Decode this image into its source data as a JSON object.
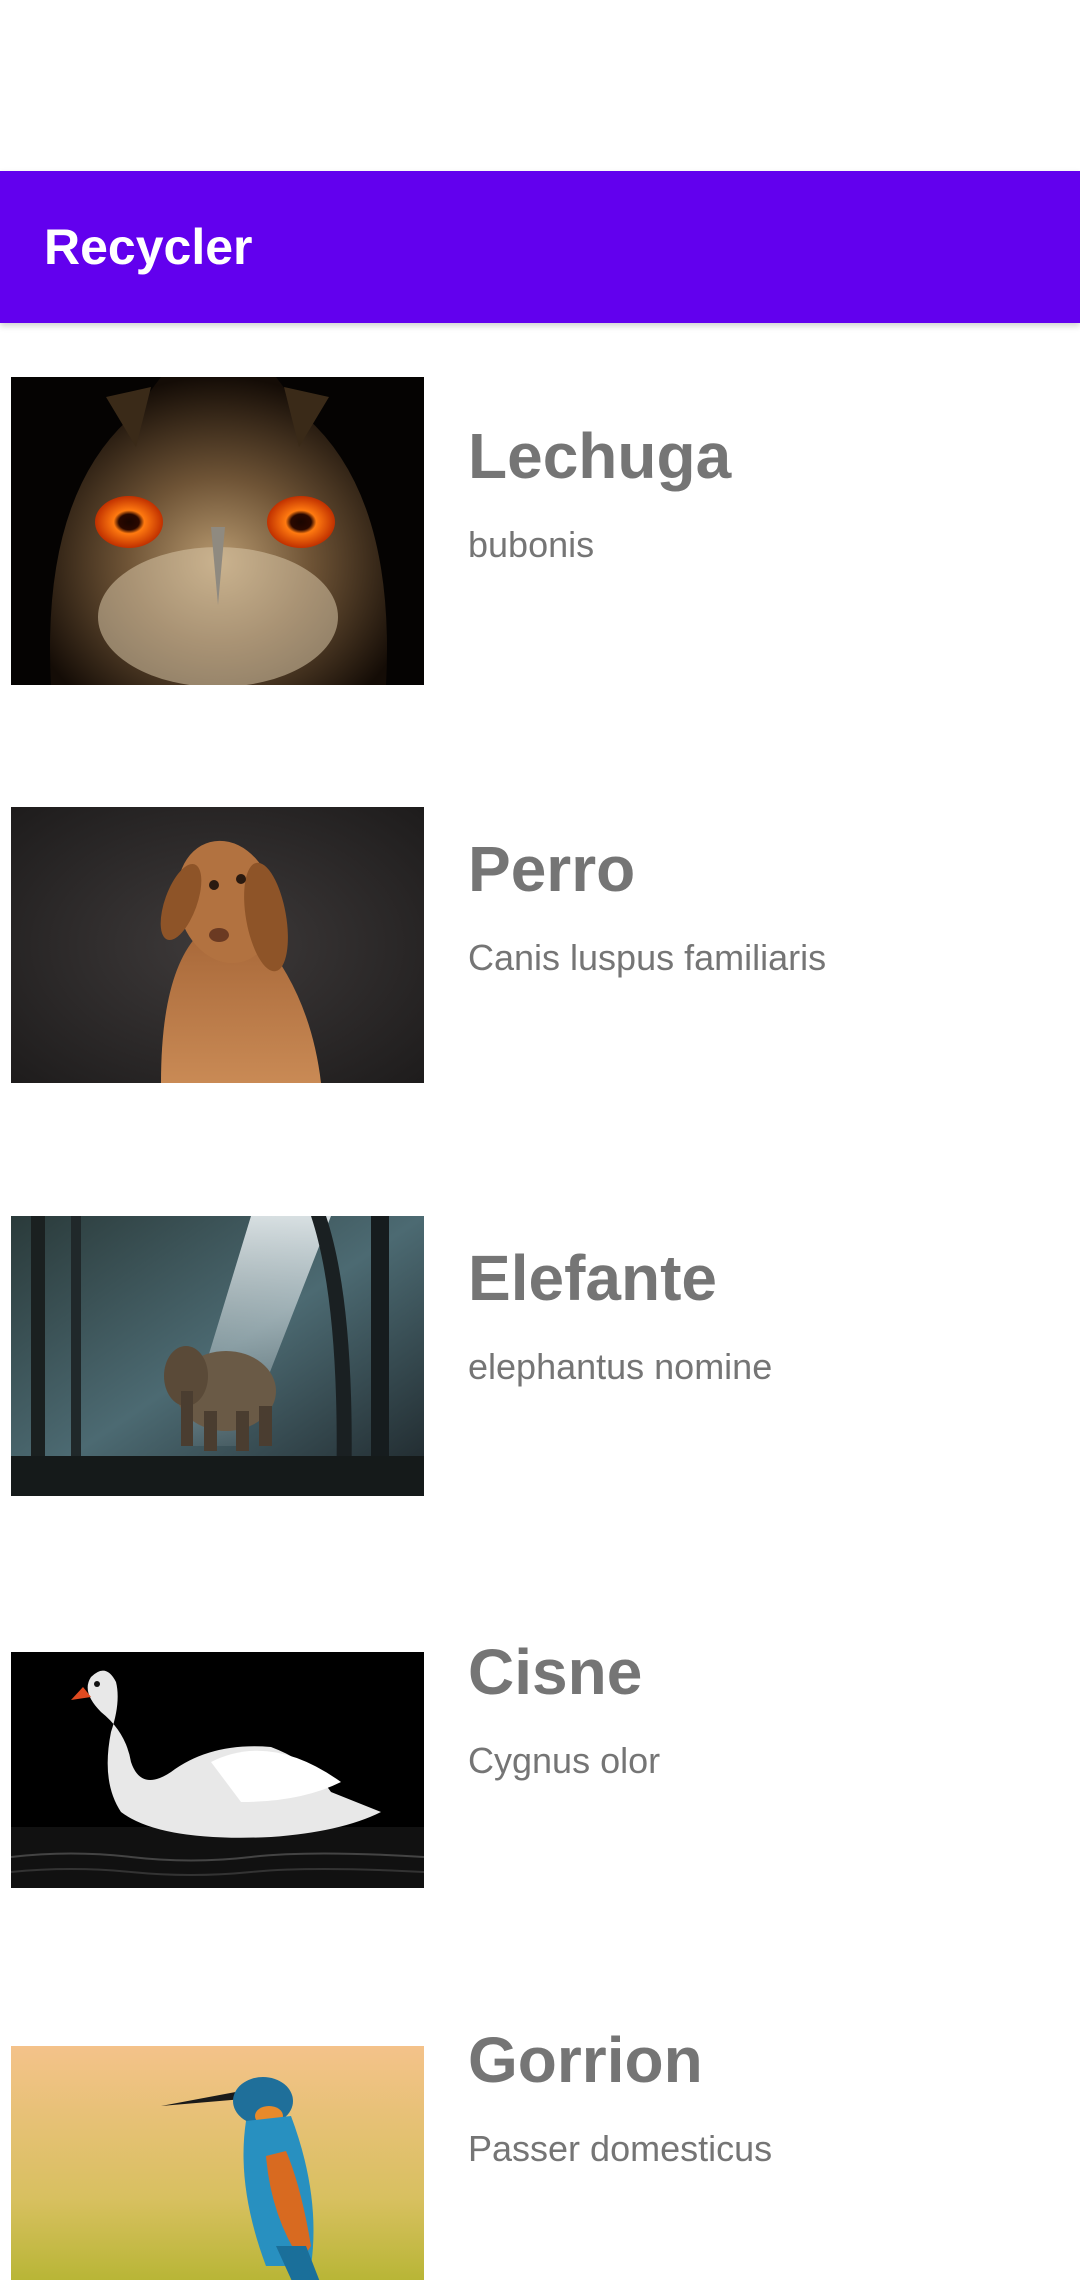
{
  "app_bar": {
    "title": "Recycler",
    "color": "#6200ee"
  },
  "items": [
    {
      "title": "Lechuga",
      "subtitle": "bubonis",
      "image": "owl-photo"
    },
    {
      "title": "Perro",
      "subtitle": "Canis luspus familiaris",
      "image": "dog-photo"
    },
    {
      "title": "Elefante",
      "subtitle": "elephantus nomine",
      "image": "elephant-photo"
    },
    {
      "title": "Cisne",
      "subtitle": "Cygnus olor",
      "image": "swan-photo"
    },
    {
      "title": "Gorrion",
      "subtitle": "Passer domesticus",
      "image": "kingfisher-photo"
    }
  ]
}
